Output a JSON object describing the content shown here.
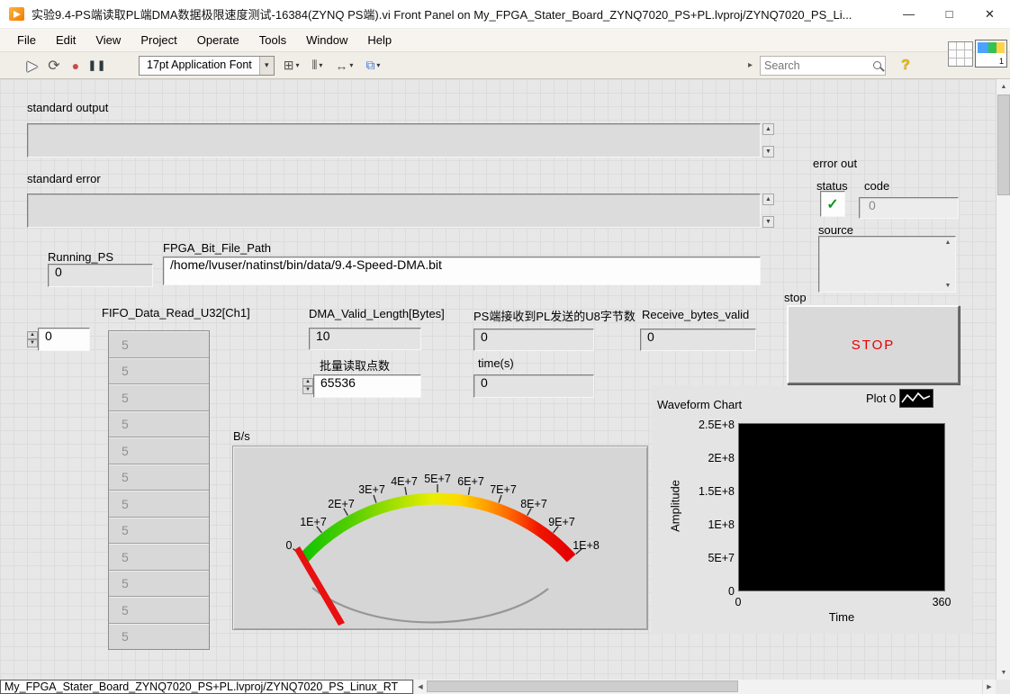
{
  "window": {
    "title": "实验9.4-PS端读取PL端DMA数据极限速度测试-16384(ZYNQ PS端).vi Front Panel on My_FPGA_Stater_Board_ZYNQ7020_PS+PL.lvproj/ZYNQ7020_PS_Li...",
    "vi_icon_text": "1"
  },
  "icons": {
    "minimize": "—",
    "maximize": "□",
    "close": "✕",
    "run": "▶",
    "run_continuous": "⟳",
    "abort": "●",
    "pause": "❚❚",
    "dropdown_arrow": "▾",
    "align": "⊞",
    "distribute": "⫴",
    "resize": "↔",
    "reorder": "⧉",
    "expand": "▸",
    "help": "?",
    "scroll_up": "▲",
    "scroll_down": "▼",
    "scroll_left": "◀",
    "scroll_right": "▶",
    "spin_up": "▲",
    "spin_down": "▼",
    "check": "✓"
  },
  "menubar": {
    "items": [
      "File",
      "Edit",
      "View",
      "Project",
      "Operate",
      "Tools",
      "Window",
      "Help"
    ]
  },
  "toolbar": {
    "font_selector": "17pt Application Font",
    "search_placeholder": "Search"
  },
  "panel": {
    "standard_output": {
      "label": "standard output",
      "value": ""
    },
    "standard_error": {
      "label": "standard error",
      "value": ""
    },
    "error_out": {
      "label": "error out",
      "status_label": "status",
      "code_label": "code",
      "code_value": "0",
      "source_label": "source",
      "source_value": ""
    },
    "running_ps": {
      "label": "Running_PS",
      "value": "0"
    },
    "fpga_bit_file_path": {
      "label": "FPGA_Bit_File_Path",
      "value": "/home/lvuser/natinst/bin/data/9.4-Speed-DMA.bit"
    },
    "fifo_array": {
      "label": "FIFO_Data_Read_U32[Ch1]",
      "index_value": "0",
      "values": [
        "5",
        "5",
        "5",
        "5",
        "5",
        "5",
        "5",
        "5",
        "5",
        "5",
        "5",
        "5"
      ]
    },
    "dma_valid_length": {
      "label": "DMA_Valid_Length[Bytes]",
      "value": "10"
    },
    "batch_read_points": {
      "label": "批量读取点数",
      "value": "65536"
    },
    "ps_received_bytes": {
      "label": "PS端接收到PL发送的U8字节数",
      "value": "0"
    },
    "time_s": {
      "label": "time(s)",
      "value": "0"
    },
    "receive_bytes_valid": {
      "label": "Receive_bytes_valid",
      "value": "0"
    },
    "stop": {
      "label": "stop",
      "button_label": "STOP",
      "button_text_color": "#e60000"
    },
    "gauge": {
      "label": "B/s",
      "ticks": [
        "0",
        "1E+7",
        "2E+7",
        "3E+7",
        "4E+7",
        "5E+7",
        "6E+7",
        "7E+7",
        "8E+7",
        "9E+7",
        "1E+8"
      ],
      "needle_color": "#e81010"
    },
    "waveform_chart": {
      "label": "Waveform Chart",
      "legend": "Plot 0",
      "y_axis_label": "Amplitude",
      "x_axis_label": "Time",
      "y_ticks": [
        "2.5E+8",
        "2E+8",
        "1.5E+8",
        "1E+8",
        "5E+7",
        "0"
      ],
      "x_ticks": [
        "0",
        "360"
      ],
      "plot_bg": "#000000"
    }
  },
  "statusbar": {
    "context_path": "My_FPGA_Stater_Board_ZYNQ7020_PS+PL.lvproj/ZYNQ7020_PS_Linux_RT"
  }
}
